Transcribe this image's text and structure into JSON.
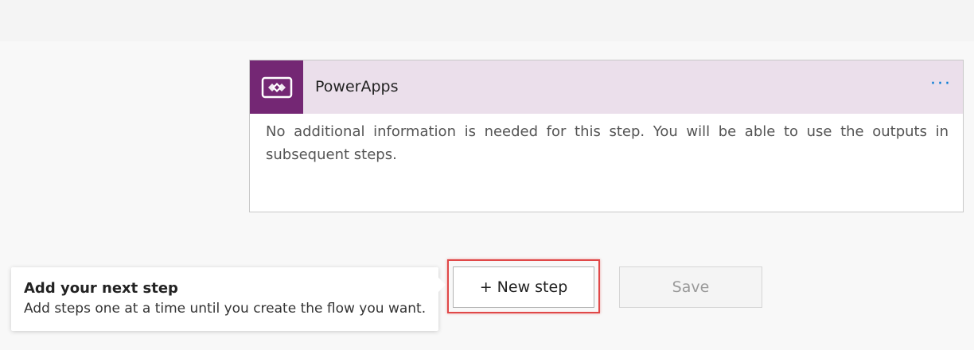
{
  "card": {
    "title": "PowerApps",
    "menu_label": "···",
    "icon": "powerapps-icon",
    "body": "No additional information is needed for this step. You will be able to use the outputs in subsequent steps.",
    "header_color": "#ebdfeb",
    "icon_bg_color": "#742774"
  },
  "tooltip": {
    "title": "Add your next step",
    "text": "Add steps one at a time until you create the flow you want."
  },
  "actions": {
    "new_step_label": "+ New step",
    "save_label": "Save",
    "highlight_color": "#e04848"
  }
}
